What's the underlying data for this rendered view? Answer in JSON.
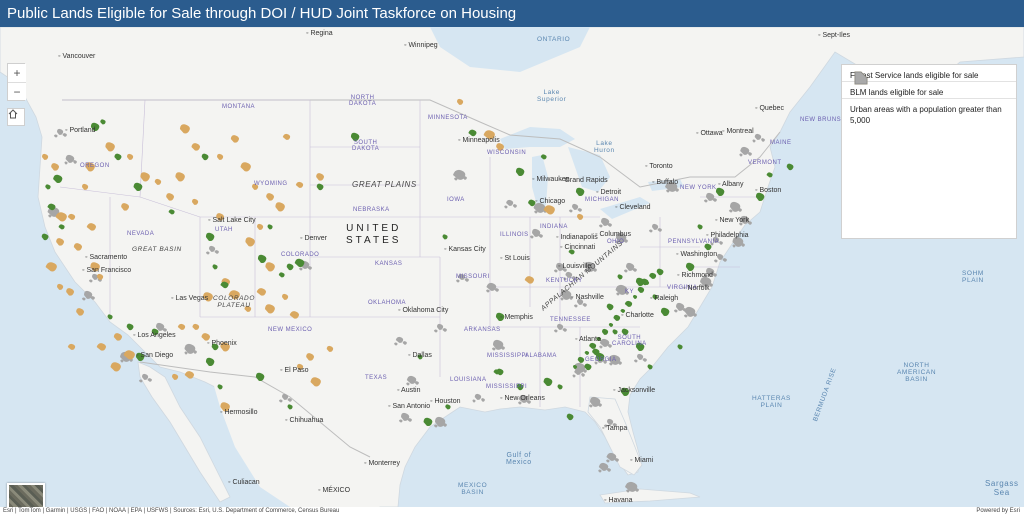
{
  "header": {
    "title": "Public Lands Eligible for Sale through DOI / HUD Joint Taskforce on Housing"
  },
  "controls": {
    "zoom_in": "+",
    "zoom_out": "−",
    "home_icon": "home-icon",
    "basemap_icon": "basemap-thumbnail"
  },
  "legend": {
    "items": [
      {
        "label": "Forest Service lands eligible for sale",
        "color": "#4a8a34"
      },
      {
        "label": "BLM lands eligible for sale",
        "color": "#d9a860"
      },
      {
        "label": "Urban areas with a population greater than 5,000",
        "color": "#a9a9a9"
      }
    ]
  },
  "map": {
    "colors": {
      "water": "#d6e6f2",
      "land": "#f4f4f2",
      "forest": "#4a8a34",
      "blm": "#d9a860",
      "urban": "#a6a6a6",
      "state_border": "#c8bfd8",
      "country_border": "#bdbdbd"
    },
    "country_label": "UNITED\nSTATES",
    "region_labels": [
      "GREAT PLAINS",
      "GREAT BASIN",
      "COLORADO\nPLATEAU",
      "APPALACHIAN MOUNTAINS"
    ],
    "water_labels": [
      "ONTARIO",
      "Lake\nSuperior",
      "Lake\nHuron",
      "Gulf of\nMexico",
      "SOHM\nPLAIN",
      "NORTH\nAMERICAN\nBASIN",
      "HATTERAS\nPLAIN",
      "BERMUDA RISE",
      "Sargass\nSea",
      "MEXICO\nBASIN"
    ],
    "state_labels": [
      "MONTANA",
      "NORTH\nDAKOTA",
      "MINNESOTA",
      "SOUTH\nDAKOTA",
      "WISCONSIN",
      "MICHIGAN",
      "OREGON",
      "WYOMING",
      "NEBRASKA",
      "IOWA",
      "ILLINOIS",
      "INDIANA",
      "OHIO",
      "NEVADA",
      "UTAH",
      "COLORADO",
      "KANSAS",
      "MISSOURI",
      "KENTUCKY",
      "OKLAHOMA",
      "ARKANSAS",
      "TENNESSEE",
      "NEW MEXICO",
      "TEXAS",
      "LOUISIANA",
      "MISSISSIPPI",
      "ALABAMA",
      "GEORGIA",
      "SOUTH\nCAROLINA",
      "NEW BRUNSWICK",
      "MAINE",
      "VERMONT",
      "NEW YORK",
      "PENNSYLVANIA",
      "VIRGINIA",
      "KY",
      "MISSISSIPPI"
    ],
    "city_labels": [
      "Regina",
      "Winnipeg",
      "Vancouver",
      "Sept-Iles",
      "Portland",
      "Minneapolis",
      "Quebec",
      "Ottawa",
      "Montreal",
      "Toronto",
      "Buffalo",
      "Albany",
      "Boston",
      "Milwaukee",
      "Grand Rapids",
      "Detroit",
      "Chicago",
      "Cleveland",
      "New York",
      "Salt Lake City",
      "Denver",
      "Philadelphia",
      "Indianapolis",
      "Columbus",
      "Kansas City",
      "Cincinnati",
      "Washington",
      "Sacramento",
      "San Francisco",
      "St Louis",
      "Louisville",
      "Las Vegas",
      "Richmond",
      "Nashville",
      "Norfolk",
      "Raleigh",
      "Oklahoma City",
      "Memphis",
      "Los Angeles",
      "Phoenix",
      "Charlotte",
      "San Diego",
      "Atlanta",
      "Dallas",
      "El Paso",
      "Jacksonville",
      "Austin",
      "Houston",
      "New Orleans",
      "San Antonio",
      "Hermosillo",
      "Chihuahua",
      "Tampa",
      "Miami",
      "Monterrey",
      "Culiacan",
      "MÉXICO",
      "Havana"
    ],
    "forest_parcels": [
      [
        48,
        160
      ],
      [
        52,
        180
      ],
      [
        58,
        152
      ],
      [
        62,
        200
      ],
      [
        45,
        210
      ],
      [
        95,
        100
      ],
      [
        103,
        95
      ],
      [
        118,
        130
      ],
      [
        138,
        160
      ],
      [
        172,
        185
      ],
      [
        205,
        130
      ],
      [
        210,
        210
      ],
      [
        215,
        240
      ],
      [
        225,
        258
      ],
      [
        262,
        232
      ],
      [
        282,
        248
      ],
      [
        290,
        240
      ],
      [
        300,
        236
      ],
      [
        270,
        200
      ],
      [
        215,
        320
      ],
      [
        210,
        335
      ],
      [
        220,
        360
      ],
      [
        155,
        305
      ],
      [
        140,
        330
      ],
      [
        110,
        290
      ],
      [
        130,
        300
      ],
      [
        260,
        350
      ],
      [
        290,
        380
      ],
      [
        320,
        160
      ],
      [
        355,
        110
      ],
      [
        445,
        210
      ],
      [
        473,
        106
      ],
      [
        520,
        145
      ],
      [
        544,
        130
      ],
      [
        532,
        176
      ],
      [
        580,
        165
      ],
      [
        620,
        250
      ],
      [
        610,
        280
      ],
      [
        640,
        255
      ],
      [
        655,
        270
      ],
      [
        625,
        305
      ],
      [
        640,
        320
      ],
      [
        650,
        340
      ],
      [
        588,
        340
      ],
      [
        600,
        330
      ],
      [
        615,
        305
      ],
      [
        596,
        325
      ],
      [
        500,
        290
      ],
      [
        497,
        345
      ],
      [
        520,
        360
      ],
      [
        548,
        355
      ],
      [
        560,
        360
      ],
      [
        570,
        390
      ],
      [
        428,
        395
      ],
      [
        448,
        380
      ],
      [
        500,
        345
      ],
      [
        625,
        365
      ],
      [
        680,
        320
      ],
      [
        660,
        245
      ],
      [
        690,
        240
      ],
      [
        700,
        200
      ],
      [
        708,
        220
      ],
      [
        760,
        170
      ],
      [
        770,
        148
      ],
      [
        790,
        140
      ],
      [
        720,
        165
      ],
      [
        572,
        225
      ],
      [
        645,
        255
      ],
      [
        665,
        285
      ],
      [
        420,
        330
      ]
    ],
    "blm_parcels": [
      [
        45,
        130
      ],
      [
        55,
        140
      ],
      [
        62,
        190
      ],
      [
        72,
        190
      ],
      [
        78,
        220
      ],
      [
        90,
        140
      ],
      [
        85,
        160
      ],
      [
        92,
        200
      ],
      [
        95,
        240
      ],
      [
        100,
        250
      ],
      [
        60,
        215
      ],
      [
        52,
        240
      ],
      [
        60,
        260
      ],
      [
        70,
        265
      ],
      [
        110,
        120
      ],
      [
        130,
        130
      ],
      [
        125,
        180
      ],
      [
        145,
        150
      ],
      [
        158,
        155
      ],
      [
        170,
        170
      ],
      [
        180,
        150
      ],
      [
        195,
        175
      ],
      [
        196,
        120
      ],
      [
        185,
        102
      ],
      [
        220,
        130
      ],
      [
        235,
        112
      ],
      [
        246,
        140
      ],
      [
        255,
        160
      ],
      [
        270,
        170
      ],
      [
        280,
        180
      ],
      [
        300,
        158
      ],
      [
        220,
        190
      ],
      [
        250,
        215
      ],
      [
        260,
        200
      ],
      [
        262,
        265
      ],
      [
        270,
        282
      ],
      [
        285,
        270
      ],
      [
        295,
        288
      ],
      [
        235,
        268
      ],
      [
        248,
        282
      ],
      [
        226,
        255
      ],
      [
        208,
        270
      ],
      [
        196,
        300
      ],
      [
        206,
        310
      ],
      [
        225,
        320
      ],
      [
        182,
        300
      ],
      [
        118,
        310
      ],
      [
        130,
        328
      ],
      [
        175,
        350
      ],
      [
        190,
        348
      ],
      [
        225,
        380
      ],
      [
        300,
        340
      ],
      [
        310,
        330
      ],
      [
        316,
        355
      ],
      [
        330,
        322
      ],
      [
        102,
        320
      ],
      [
        116,
        340
      ],
      [
        72,
        320
      ],
      [
        80,
        285
      ],
      [
        270,
        240
      ],
      [
        287,
        110
      ],
      [
        320,
        150
      ],
      [
        490,
        108
      ],
      [
        460,
        75
      ],
      [
        500,
        120
      ],
      [
        550,
        183
      ],
      [
        580,
        190
      ],
      [
        530,
        253
      ]
    ],
    "urban_areas": [
      [
        60,
        105
      ],
      [
        70,
        132
      ],
      [
        54,
        185
      ],
      [
        95,
        250
      ],
      [
        88,
        268
      ],
      [
        126,
        330
      ],
      [
        145,
        350
      ],
      [
        160,
        300
      ],
      [
        190,
        322
      ],
      [
        212,
        222
      ],
      [
        305,
        238
      ],
      [
        460,
        148
      ],
      [
        510,
        176
      ],
      [
        536,
        206
      ],
      [
        540,
        181
      ],
      [
        575,
        180
      ],
      [
        605,
        195
      ],
      [
        621,
        211
      ],
      [
        716,
        213
      ],
      [
        745,
        193
      ],
      [
        738,
        215
      ],
      [
        720,
        230
      ],
      [
        710,
        245
      ],
      [
        706,
        255
      ],
      [
        569,
        248
      ],
      [
        560,
        240
      ],
      [
        590,
        240
      ],
      [
        462,
        250
      ],
      [
        492,
        260
      ],
      [
        566,
        268
      ],
      [
        580,
        275
      ],
      [
        680,
        280
      ],
      [
        690,
        285
      ],
      [
        560,
        300
      ],
      [
        605,
        316
      ],
      [
        498,
        318
      ],
      [
        400,
        313
      ],
      [
        412,
        353
      ],
      [
        580,
        341
      ],
      [
        578,
        345
      ],
      [
        600,
        332
      ],
      [
        615,
        333
      ],
      [
        640,
        330
      ],
      [
        405,
        390
      ],
      [
        440,
        395
      ],
      [
        478,
        370
      ],
      [
        524,
        372
      ],
      [
        595,
        375
      ],
      [
        610,
        395
      ],
      [
        604,
        440
      ],
      [
        632,
        460
      ],
      [
        285,
        370
      ],
      [
        710,
        170
      ],
      [
        672,
        160
      ],
      [
        758,
        110
      ],
      [
        745,
        124
      ],
      [
        735,
        180
      ],
      [
        655,
        200
      ],
      [
        630,
        240
      ],
      [
        622,
        263
      ],
      [
        440,
        300
      ],
      [
        612,
        430
      ]
    ]
  },
  "attribution": {
    "sources": "Esri | TomTom | Garmin | USGS | FAO | NOAA | EPA | USFWS | Sources: Esri, U.S. Department of Commerce, Census Bureau",
    "powered": "Powered by Esri"
  }
}
